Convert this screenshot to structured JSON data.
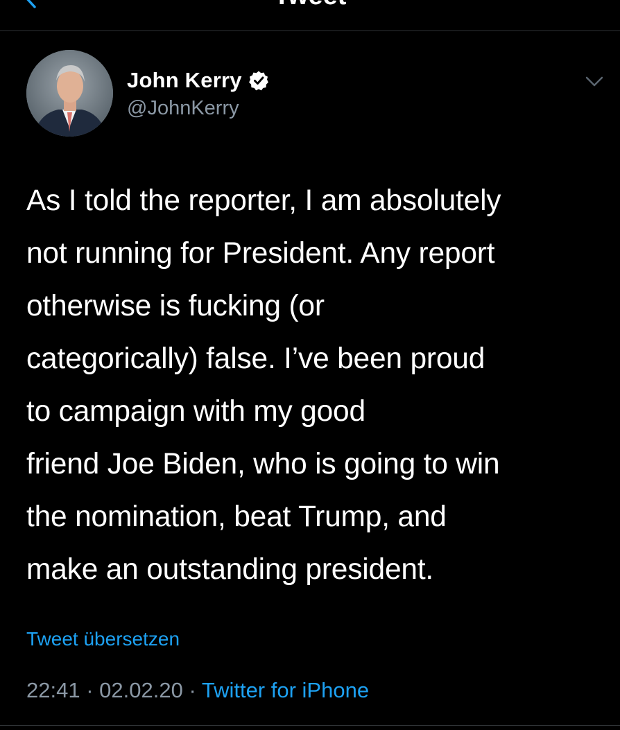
{
  "header": {
    "title": "Tweet",
    "back_icon": "chevron-left-icon"
  },
  "author": {
    "name": "John Kerry",
    "handle": "@JohnKerry",
    "verified": true
  },
  "tweet": {
    "text": "As I told the reporter, I am absolutely\nnot running for President. Any report\notherwise is fucking (or\ncategorically) false. I’ve been proud\nto campaign with my good\nfriend Joe Biden, who is going to win\nthe nomination, beat Trump, and\nmake an outstanding president.",
    "translate_label": "Tweet übersetzen",
    "time": "22:41",
    "date": "02.02.20",
    "separator": "·",
    "source": "Twitter for iPhone"
  },
  "colors": {
    "background": "#000000",
    "link": "#1da1f2",
    "secondary_text": "#8b98a5",
    "divider": "#2f3336"
  }
}
